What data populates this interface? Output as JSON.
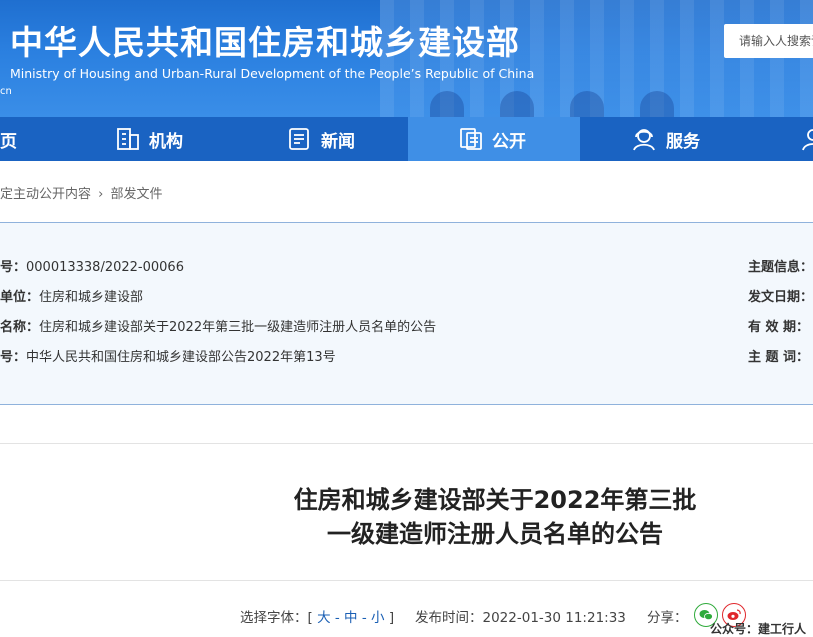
{
  "header": {
    "title_cn": "中华人民共和国住房和城乡建设部",
    "title_en": "Ministry of Housing and Urban-Rural Development of the People’s Republic of China",
    "url_fragment": "cn",
    "search_placeholder": "请输入人搜索词"
  },
  "nav": {
    "items": [
      {
        "label": "页",
        "icon": "home-icon"
      },
      {
        "label": "机构",
        "icon": "building-icon"
      },
      {
        "label": "新闻",
        "icon": "news-icon"
      },
      {
        "label": "公开",
        "icon": "document-icon"
      },
      {
        "label": "服务",
        "icon": "service-icon"
      }
    ],
    "active_index": 3
  },
  "breadcrumb": {
    "part1": "定主动公开内容",
    "separator": "›",
    "part2": "部发文件"
  },
  "info": {
    "rows": [
      {
        "label": "号：",
        "value": "000013338/2022-00066"
      },
      {
        "label": "单位：",
        "value": "住房和城乡建设部"
      },
      {
        "label": "名称：",
        "value": "住房和城乡建设部关于2022年第三批一级建造师注册人员名单的公告"
      },
      {
        "label": "号：",
        "value": "中华人民共和国住房和城乡建设部公告2022年第13号"
      }
    ],
    "right_labels": [
      "主题信息：",
      "发文日期：",
      "有 效 期：",
      "主 题 词："
    ]
  },
  "document": {
    "title_line1": "住房和城乡建设部关于2022年第三批",
    "title_line2": "一级建造师注册人员名单的公告"
  },
  "meta": {
    "font_size_label": "选择字体：[",
    "font_large": "大",
    "font_medium": "中",
    "font_small": "小",
    "font_sep": "-",
    "font_close": "]",
    "publish_label": "发布时间：",
    "publish_time": "2022-01-30 11:21:33",
    "share_label": "分享："
  },
  "watermark": "公众号：建工行人",
  "colors": {
    "banner": "#2b80e0",
    "nav": "#1a63c2",
    "nav_active": "#3f8fe6",
    "info_bg": "#f3f8fd",
    "link": "#1a5fb4"
  }
}
